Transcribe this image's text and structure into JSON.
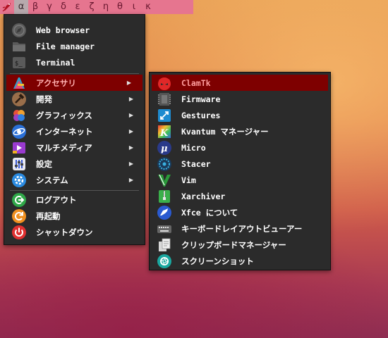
{
  "panel": {
    "workspaces": [
      "α",
      "β",
      "γ",
      "δ",
      "ε",
      "ζ",
      "η",
      "θ",
      "ι",
      "κ"
    ],
    "active_workspace": 0
  },
  "main_menu": {
    "favorites": [
      {
        "label": "Web browser",
        "icon": "compass-icon"
      },
      {
        "label": "File manager",
        "icon": "folder-icon"
      },
      {
        "label": "Terminal",
        "icon": "terminal-icon"
      }
    ],
    "categories": [
      {
        "label": "アクセサリ",
        "icon": "accessories-icon",
        "selected": true
      },
      {
        "label": "開発",
        "icon": "hammer-icon"
      },
      {
        "label": "グラフィックス",
        "icon": "graphics-icon"
      },
      {
        "label": "インターネット",
        "icon": "internet-icon"
      },
      {
        "label": "マルチメディア",
        "icon": "multimedia-icon"
      },
      {
        "label": "設定",
        "icon": "settings-icon"
      },
      {
        "label": "システム",
        "icon": "system-icon"
      }
    ],
    "actions": [
      {
        "label": "ログアウト",
        "icon": "logout-icon"
      },
      {
        "label": "再起動",
        "icon": "restart-icon"
      },
      {
        "label": "シャットダウン",
        "icon": "shutdown-icon"
      }
    ],
    "arrow": "▶"
  },
  "sub_menu": {
    "items": [
      {
        "label": "ClamTk",
        "icon": "clamtk-icon",
        "selected": true
      },
      {
        "label": "Firmware",
        "icon": "firmware-icon"
      },
      {
        "label": "Gestures",
        "icon": "gestures-icon"
      },
      {
        "label": "Kvantum マネージャー",
        "icon": "kvantum-icon"
      },
      {
        "label": "Micro",
        "icon": "micro-icon"
      },
      {
        "label": "Stacer",
        "icon": "stacer-icon"
      },
      {
        "label": "Vim",
        "icon": "vim-icon"
      },
      {
        "label": "Xarchiver",
        "icon": "archive-icon"
      },
      {
        "label": "Xfce について",
        "icon": "xfce-icon"
      },
      {
        "label": "キーボードレイアウトビューアー",
        "icon": "keyboard-icon"
      },
      {
        "label": "クリップボードマネージャー",
        "icon": "clipboard-icon"
      },
      {
        "label": "スクリーンショット",
        "icon": "screenshot-icon"
      }
    ]
  },
  "colors": {
    "menu_bg": "#2b2b2b",
    "selection": "#7e0000",
    "panel": "#e6758f"
  }
}
